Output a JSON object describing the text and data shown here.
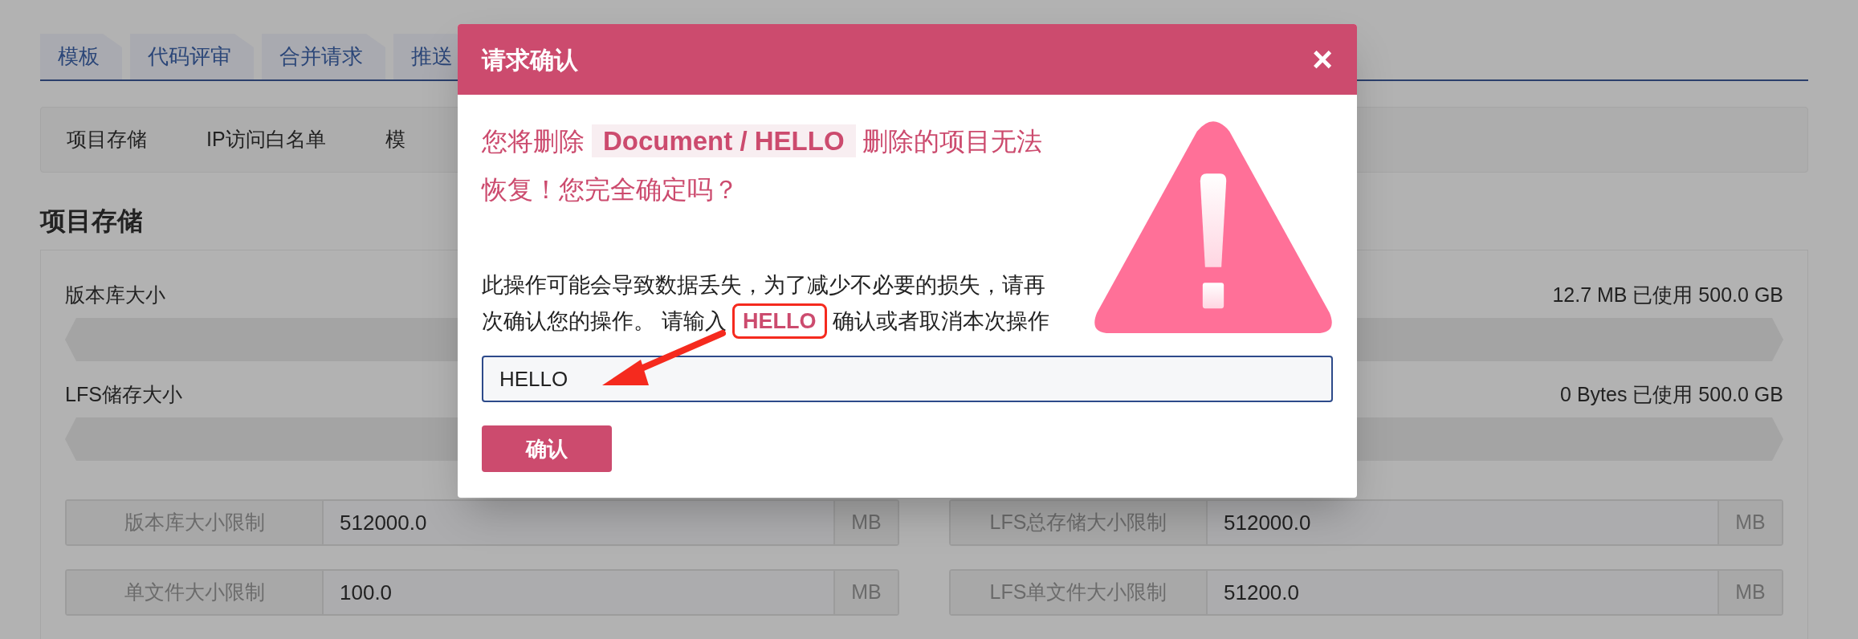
{
  "tabs": [
    {
      "label": "模板"
    },
    {
      "label": "代码评审"
    },
    {
      "label": "合并请求"
    },
    {
      "label": "推送"
    }
  ],
  "subnav": [
    {
      "label": "项目存储"
    },
    {
      "label": "IP访问白名单"
    },
    {
      "label": "模"
    }
  ],
  "section_title": "项目存储",
  "usage": [
    {
      "label": "版本库大小",
      "reading": "12.7 MB 已使用 500.0 GB"
    },
    {
      "label": "LFS储存大小",
      "reading": "0 Bytes 已使用 500.0 GB"
    }
  ],
  "limits": [
    {
      "label": "版本库大小限制",
      "value": "512000.0",
      "unit": "MB"
    },
    {
      "label": "LFS总存储大小限制",
      "value": "512000.0",
      "unit": "MB"
    },
    {
      "label": "单文件大小限制",
      "value": "100.0",
      "unit": "MB"
    },
    {
      "label": "LFS单文件大小限制",
      "value": "51200.0",
      "unit": "MB"
    }
  ],
  "dialog": {
    "title": "请求确认",
    "close": "×",
    "heading": {
      "before": "您将删除",
      "repo": "Document / HELLO",
      "after": "删除的项目无法恢复！您完全确定吗？"
    },
    "message": {
      "before": "此操作可能会导致数据丢失，为了减少不必要的损失，请再次确认您的操作。 请输入",
      "keyword": "HELLO",
      "after": "确认或者取消本次操作"
    },
    "input": {
      "value": "HELLO"
    },
    "confirm": "确认"
  }
}
